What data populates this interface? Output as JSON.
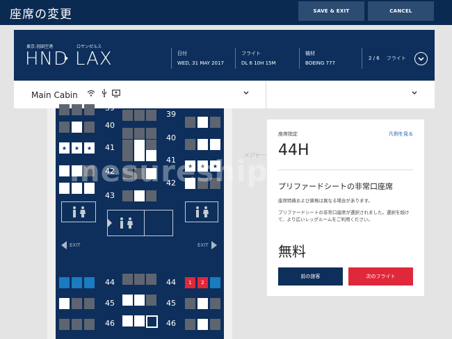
{
  "topbar": {
    "title": "座席の変更",
    "save_label": "SAVE & EXIT",
    "cancel_label": "CANCEL"
  },
  "flight": {
    "origin_city": "東京-羽田空港",
    "origin_code": "HND",
    "dest_city": "ロサンゼルス",
    "dest_code": "LAX",
    "date_label": "日付",
    "date_value": "WED, 31 MAY 2017",
    "flight_label": "フライト",
    "flight_value": "DL 6 10H 15M",
    "aircraft_label": "機材",
    "aircraft_value": "BOEING 777",
    "page_indicator": "2 / 6",
    "page_label": "フライト"
  },
  "cabin": {
    "name": "Main Cabin",
    "amenities": [
      "wifi-icon",
      "usb-power-icon",
      "seatback-screen-icon"
    ]
  },
  "seatmap": {
    "rows_top": [
      "39",
      "40",
      "41",
      "42",
      "43"
    ],
    "rows_bottom": [
      "44",
      "45",
      "46"
    ],
    "exit_left": "EXIT",
    "exit_right": "EXIT",
    "red_seat_1": "1",
    "red_seat_2": "2",
    "star": "★"
  },
  "panel": {
    "label": "座席指定",
    "legend_link": "凡例を見る",
    "seat": "44H",
    "seat_type": "プリファードシートの非常口座席",
    "note": "座席特典および資格は異なる場合があります。",
    "description": "プリファードシートの非常口座席が選択されました。選択を続けて、より広いレッグルームをご利用ください。",
    "price": "無料",
    "prev_label": "前の旅客",
    "next_label": "次のフライト"
  },
  "watermark": {
    "main": "mesureship.com",
    "sub": "メジャートリップ"
  },
  "colors": {
    "navy": "#0e2f5b",
    "red": "#e0283b",
    "blue": "#1a7bc2"
  }
}
